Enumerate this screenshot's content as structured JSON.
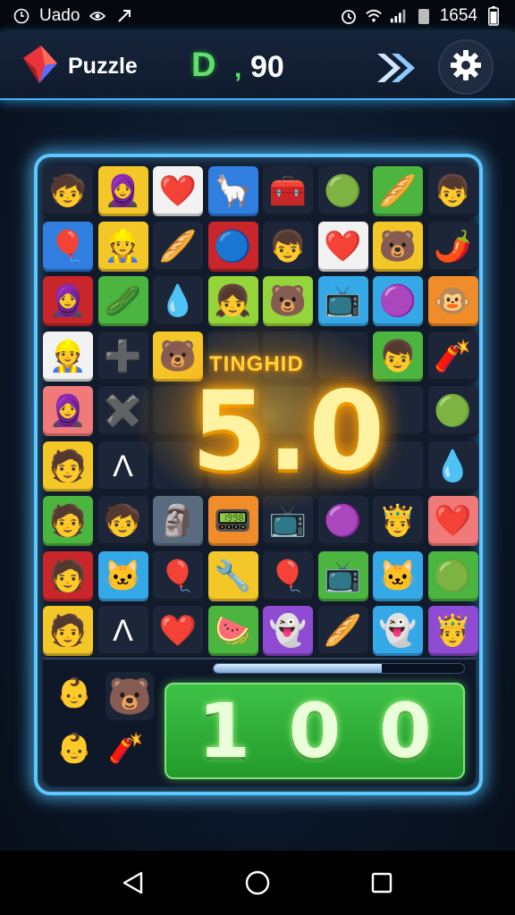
{
  "status_bar": {
    "carrier": "Uado",
    "time": "1654"
  },
  "header": {
    "app_title": "Puzzle",
    "score_icon_text": "D",
    "score_separator": ",",
    "score_value": "90"
  },
  "combo": {
    "label": "TINGHID",
    "value": "5.0"
  },
  "counter": {
    "digits": [
      "1",
      "0",
      "0"
    ]
  },
  "progress": {
    "fraction": 0.67
  },
  "colors": {
    "accent": "#5cc8ff",
    "combo_gold": "#ffd240",
    "counter_green": "#3fc247"
  },
  "board": {
    "rows": [
      [
        {
          "bg": "dark",
          "glyph": "🧒"
        },
        {
          "bg": "yellow",
          "glyph": "🧕"
        },
        {
          "bg": "white",
          "glyph": "❤️"
        },
        {
          "bg": "blue",
          "glyph": "🦙"
        },
        {
          "bg": "dark",
          "glyph": "🧰"
        },
        {
          "bg": "dark",
          "glyph": "🟢"
        },
        {
          "bg": "green",
          "glyph": "🥖"
        },
        {
          "bg": "dark",
          "glyph": "👦"
        }
      ],
      [
        {
          "bg": "blue",
          "glyph": "🎈"
        },
        {
          "bg": "yellow",
          "glyph": "👷"
        },
        {
          "bg": "dark",
          "glyph": "🥖"
        },
        {
          "bg": "red",
          "glyph": "🔵"
        },
        {
          "bg": "dark",
          "glyph": "👦"
        },
        {
          "bg": "white",
          "glyph": "❤️"
        },
        {
          "bg": "yellow",
          "glyph": "🐻"
        },
        {
          "bg": "dark",
          "glyph": "🌶️"
        }
      ],
      [
        {
          "bg": "red",
          "glyph": "🧕"
        },
        {
          "bg": "green",
          "glyph": "🥒"
        },
        {
          "bg": "dark",
          "glyph": "💧"
        },
        {
          "bg": "lime",
          "glyph": "👧"
        },
        {
          "bg": "lime",
          "glyph": "🐻"
        },
        {
          "bg": "cyan",
          "glyph": "📺"
        },
        {
          "bg": "cyan",
          "glyph": "🟣"
        },
        {
          "bg": "orange",
          "glyph": "🐵"
        }
      ],
      [
        {
          "bg": "white",
          "glyph": "👷"
        },
        {
          "bg": "dark",
          "glyph": "➕"
        },
        {
          "bg": "yellow",
          "glyph": "🐻"
        },
        {
          "bg": "dark",
          "glyph": ""
        },
        {
          "bg": "dark",
          "glyph": ""
        },
        {
          "bg": "dark",
          "glyph": ""
        },
        {
          "bg": "green",
          "glyph": "👦"
        },
        {
          "bg": "dark",
          "glyph": "🧨"
        }
      ],
      [
        {
          "bg": "pink",
          "glyph": "🧕"
        },
        {
          "bg": "dark",
          "glyph": "✖️"
        },
        {
          "bg": "dark",
          "glyph": ""
        },
        {
          "bg": "dark",
          "glyph": ""
        },
        {
          "bg": "dark",
          "glyph": ""
        },
        {
          "bg": "dark",
          "glyph": ""
        },
        {
          "bg": "dark",
          "glyph": ""
        },
        {
          "bg": "dark",
          "glyph": "🟢"
        }
      ],
      [
        {
          "bg": "yellow",
          "glyph": "🧑"
        },
        {
          "bg": "dark",
          "glyph": "Λ"
        },
        {
          "bg": "dark",
          "glyph": ""
        },
        {
          "bg": "dark",
          "glyph": ""
        },
        {
          "bg": "dark",
          "glyph": ""
        },
        {
          "bg": "dark",
          "glyph": ""
        },
        {
          "bg": "dark",
          "glyph": ""
        },
        {
          "bg": "dark",
          "glyph": "💧"
        }
      ],
      [
        {
          "bg": "green",
          "glyph": "🧑"
        },
        {
          "bg": "dark",
          "glyph": "🧒"
        },
        {
          "bg": "gray",
          "glyph": "🗿"
        },
        {
          "bg": "orange",
          "glyph": "📟"
        },
        {
          "bg": "dark",
          "glyph": "📺"
        },
        {
          "bg": "dark",
          "glyph": "🟣"
        },
        {
          "bg": "dark",
          "glyph": "🤴"
        },
        {
          "bg": "pink",
          "glyph": "❤️"
        }
      ],
      [
        {
          "bg": "red",
          "glyph": "🧑"
        },
        {
          "bg": "cyan",
          "glyph": "🐱"
        },
        {
          "bg": "dark",
          "glyph": "🎈"
        },
        {
          "bg": "yellow",
          "glyph": "🔧"
        },
        {
          "bg": "dark",
          "glyph": "🎈"
        },
        {
          "bg": "green",
          "glyph": "📺"
        },
        {
          "bg": "cyan",
          "glyph": "🐱"
        },
        {
          "bg": "green",
          "glyph": "🟢"
        }
      ],
      [
        {
          "bg": "yellow",
          "glyph": "🧑"
        },
        {
          "bg": "dark",
          "glyph": "Λ"
        },
        {
          "bg": "dark",
          "glyph": "❤️"
        },
        {
          "bg": "green",
          "glyph": "🍉"
        },
        {
          "bg": "purple",
          "glyph": "👻"
        },
        {
          "bg": "dark",
          "glyph": "🥖"
        },
        {
          "bg": "cyan",
          "glyph": "👻"
        },
        {
          "bg": "purple",
          "glyph": "🤴"
        }
      ]
    ]
  },
  "booster_pieces": [
    {
      "glyph": "👶"
    },
    {
      "glyph": "🐻"
    },
    {
      "glyph": "👶"
    },
    {
      "glyph": "🧨"
    }
  ]
}
